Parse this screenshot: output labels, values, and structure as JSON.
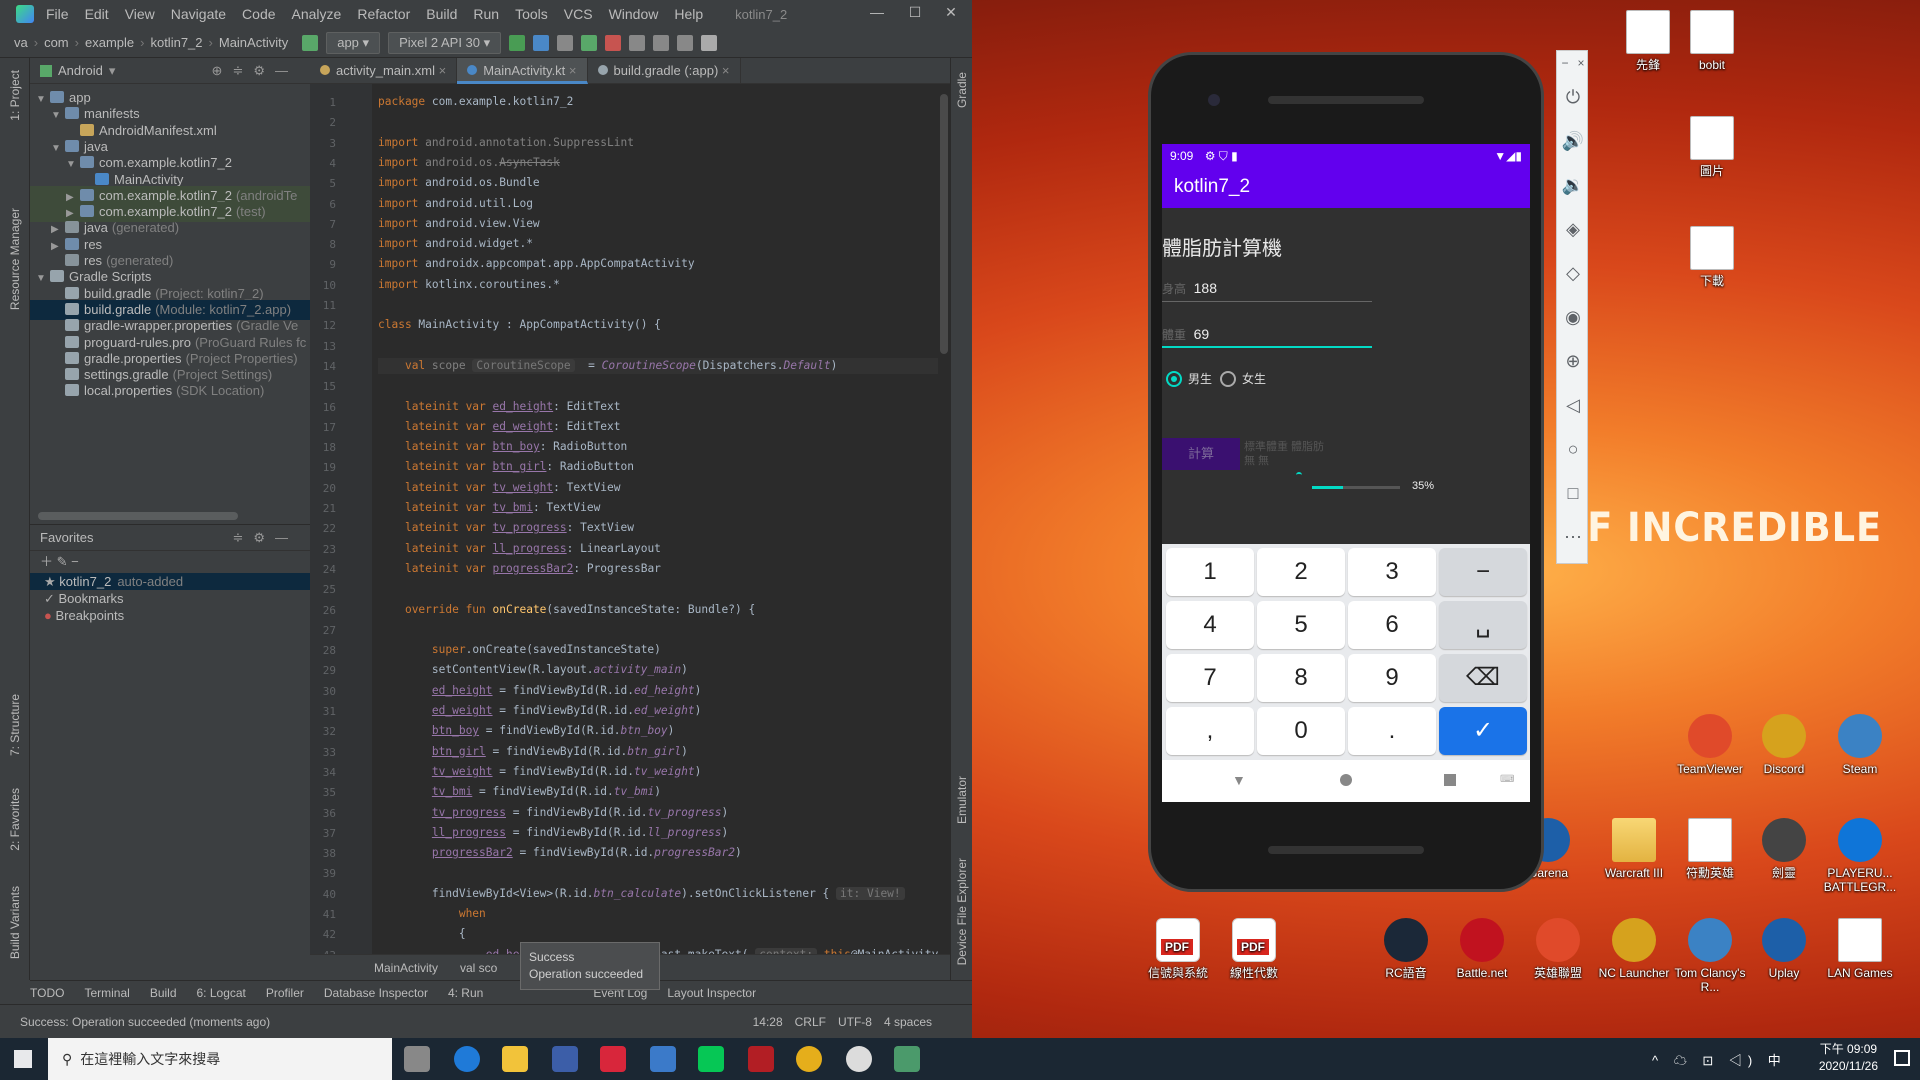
{
  "desktop": {
    "banner": "OF INCREDIBLE",
    "icons": [
      {
        "label": "先鋒",
        "type": "doc"
      },
      {
        "label": "bobit",
        "type": "doc"
      },
      {
        "label": "圖片",
        "type": "doc"
      },
      {
        "label": "下載",
        "type": "doc"
      },
      {
        "label": "TeamViewer",
        "type": "app"
      },
      {
        "label": "Discord",
        "type": "app"
      },
      {
        "label": "Steam",
        "type": "app"
      },
      {
        "label": "Garena",
        "type": "app"
      },
      {
        "label": "Warcraft III",
        "type": "folder"
      },
      {
        "label": "符勳英雄",
        "type": "doc"
      },
      {
        "label": "劍靈",
        "type": "app"
      },
      {
        "label": "PLAYERU... BATTLEGR...",
        "type": "app"
      },
      {
        "label": "信號與系統",
        "type": "pdf"
      },
      {
        "label": "線性代數",
        "type": "pdf"
      },
      {
        "label": "RC語音",
        "type": "app"
      },
      {
        "label": "Battle.net",
        "type": "app"
      },
      {
        "label": "英雄聯盟",
        "type": "app"
      },
      {
        "label": "NC Launcher",
        "type": "app"
      },
      {
        "label": "Tom Clancy's R...",
        "type": "app"
      },
      {
        "label": "Uplay",
        "type": "app"
      },
      {
        "label": "LAN Games",
        "type": "doc"
      }
    ]
  },
  "ide": {
    "menu": [
      "File",
      "Edit",
      "View",
      "Navigate",
      "Code",
      "Analyze",
      "Refactor",
      "Build",
      "Run",
      "Tools",
      "VCS",
      "Window",
      "Help"
    ],
    "title": "kotlin7_2",
    "breadcrumbs": [
      "va",
      "com",
      "example",
      "kotlin7_2",
      "MainActivity"
    ],
    "run_config": "app",
    "device": "Pixel 2 API 30",
    "left_tabs": [
      "1: Project",
      "Resource Manager",
      "7: Structure",
      "2: Favorites",
      "Build Variants"
    ],
    "project_view": "Android",
    "tree": [
      {
        "indent": 0,
        "arrow": "▼",
        "icon": "fold",
        "label": "app",
        "muted": ""
      },
      {
        "indent": 1,
        "arrow": "▼",
        "icon": "fold",
        "label": "manifests",
        "muted": ""
      },
      {
        "indent": 2,
        "arrow": "",
        "icon": "file-x",
        "label": "AndroidManifest.xml",
        "muted": ""
      },
      {
        "indent": 1,
        "arrow": "▼",
        "icon": "fold",
        "label": "java",
        "muted": ""
      },
      {
        "indent": 2,
        "arrow": "▼",
        "icon": "fold",
        "label": "com.example.kotlin7_2",
        "muted": ""
      },
      {
        "indent": 3,
        "arrow": "",
        "icon": "file-k",
        "label": "MainActivity",
        "muted": ""
      },
      {
        "indent": 2,
        "arrow": "▶",
        "icon": "fold",
        "label": "com.example.kotlin7_2",
        "muted": "(androidTe"
      },
      {
        "indent": 2,
        "arrow": "▶",
        "icon": "fold",
        "label": "com.example.kotlin7_2",
        "muted": "(test)"
      },
      {
        "indent": 1,
        "arrow": "▶",
        "icon": "fold-g",
        "label": "java",
        "muted": "(generated)"
      },
      {
        "indent": 1,
        "arrow": "▶",
        "icon": "fold",
        "label": "res",
        "muted": ""
      },
      {
        "indent": 1,
        "arrow": "",
        "icon": "fold-g",
        "label": "res",
        "muted": "(generated)"
      },
      {
        "indent": 0,
        "arrow": "▼",
        "icon": "file-gr",
        "label": "Gradle Scripts",
        "muted": ""
      },
      {
        "indent": 1,
        "arrow": "",
        "icon": "file-gr",
        "label": "build.gradle",
        "muted": "(Project: kotlin7_2)"
      },
      {
        "indent": 1,
        "arrow": "",
        "icon": "file-gr",
        "label": "build.gradle",
        "muted": "(Module: kotlin7_2.app)"
      },
      {
        "indent": 1,
        "arrow": "",
        "icon": "file-gr",
        "label": "gradle-wrapper.properties",
        "muted": "(Gradle Ve"
      },
      {
        "indent": 1,
        "arrow": "",
        "icon": "file-gr",
        "label": "proguard-rules.pro",
        "muted": "(ProGuard Rules fc"
      },
      {
        "indent": 1,
        "arrow": "",
        "icon": "file-gr",
        "label": "gradle.properties",
        "muted": "(Project Properties)"
      },
      {
        "indent": 1,
        "arrow": "",
        "icon": "file-gr",
        "label": "settings.gradle",
        "muted": "(Project Settings)"
      },
      {
        "indent": 1,
        "arrow": "",
        "icon": "file-gr",
        "label": "local.properties",
        "muted": "(SDK Location)"
      }
    ],
    "favorites": {
      "title": "Favorites",
      "items": [
        {
          "label": "kotlin7_2",
          "muted": "auto-added"
        },
        {
          "label": "Bookmarks",
          "muted": ""
        },
        {
          "label": "Breakpoints",
          "muted": ""
        }
      ]
    },
    "tabs": [
      "activity_main.xml",
      "MainActivity.kt",
      "build.gradle (:app)"
    ],
    "active_tab": 1,
    "right_tabs": [
      "Gradle",
      "Emulator",
      "Device File Explorer"
    ],
    "editor_crumbs": [
      "MainActivity",
      "val sco"
    ],
    "bottom_tools": [
      "TODO",
      "Terminal",
      "Build",
      "6: Logcat",
      "Profiler",
      "Database Inspector",
      "4: Run",
      "Event Log",
      "Layout Inspector"
    ],
    "status": {
      "message": "Success: Operation succeeded (moments ago)",
      "position": "14:28",
      "line_sep": "CRLF",
      "encoding": "UTF-8",
      "indent": "4 spaces"
    },
    "toast": {
      "title": "Success",
      "body": "Operation succeeded"
    }
  },
  "phone": {
    "time": "9:09",
    "app_title": "kotlin7_2",
    "heading": "體脂肪計算機",
    "height_hint": "身高",
    "height_value": "188",
    "weight_hint": "體重",
    "weight_value": "69",
    "radio_boy": "男生",
    "radio_girl": "女生",
    "calc_button": "計算",
    "result_line1": "標準體重 體脂肪",
    "result_line2": "無    無",
    "progress_text": "35%",
    "progress": 0.35,
    "keys": [
      "1",
      "2",
      "3",
      "−",
      "4",
      "5",
      "6",
      "␣",
      "7",
      "8",
      "9",
      "⌫",
      ",",
      "0",
      ".",
      "✓"
    ]
  },
  "taskbar": {
    "search_placeholder": "在這裡輸入文字來搜尋",
    "time": "下午 09:09",
    "date": "2020/11/26"
  }
}
